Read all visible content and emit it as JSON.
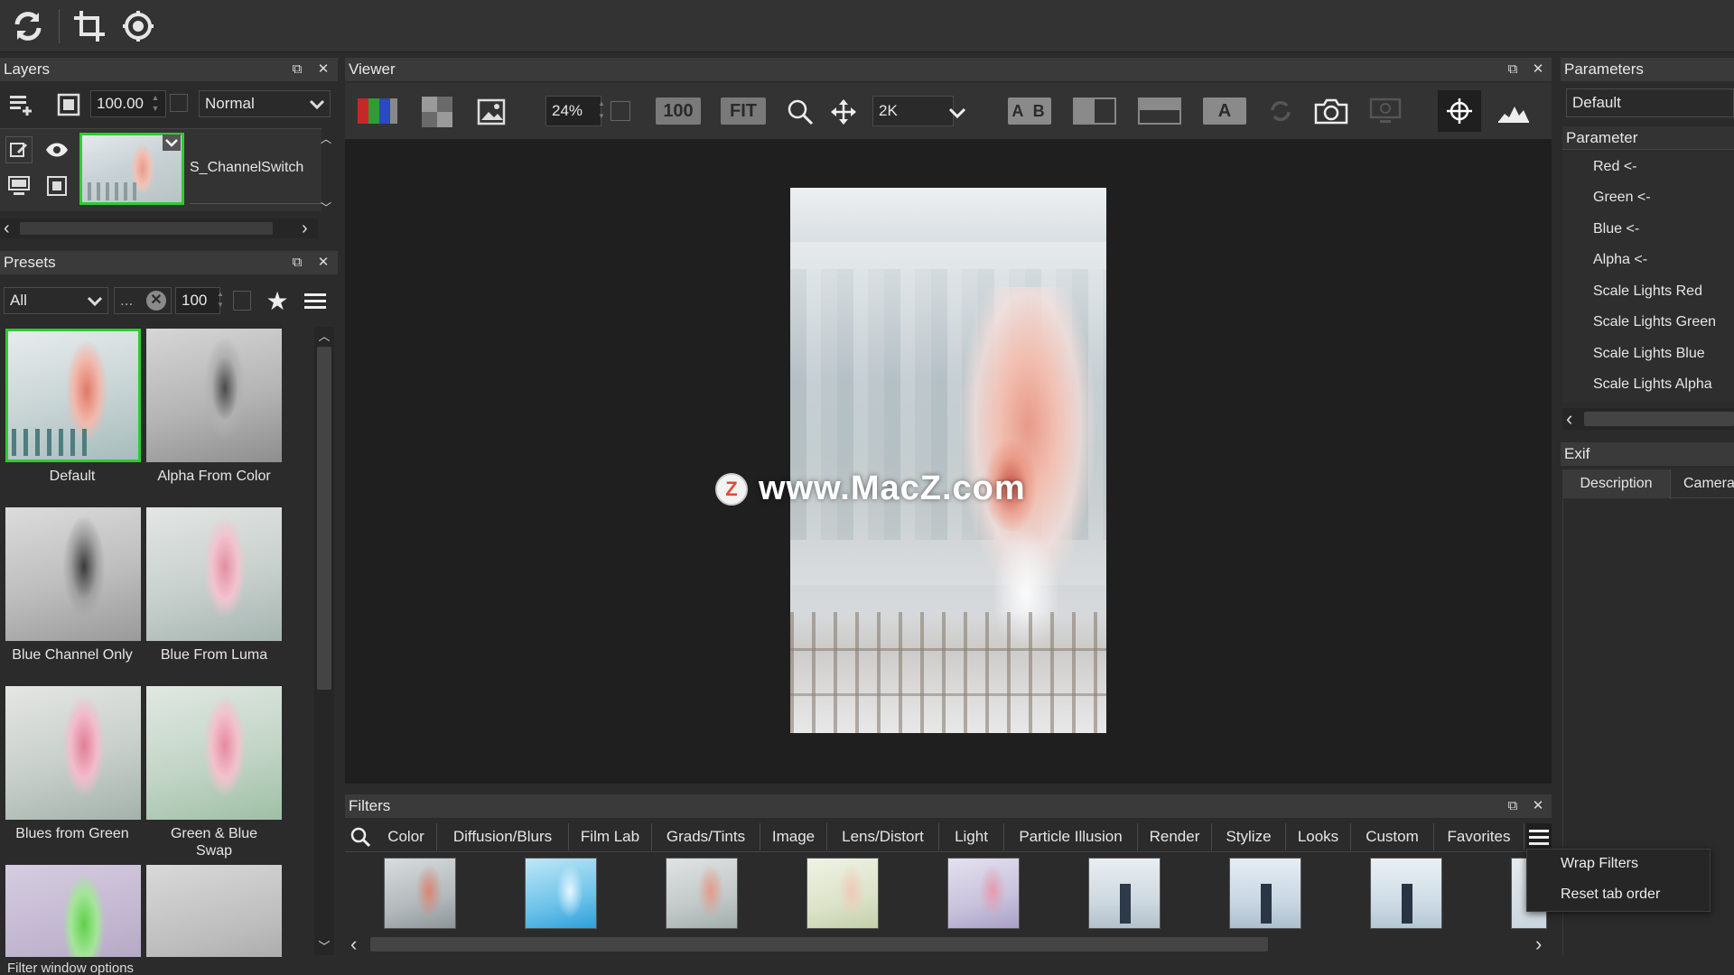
{
  "layers": {
    "title": "Layers",
    "opacity": "100.00",
    "blend_mode": "Normal",
    "layer_name": "S_ChannelSwitch"
  },
  "presets": {
    "title": "Presets",
    "category": "All",
    "search": "...",
    "amount": "100",
    "items": [
      {
        "label": "Default"
      },
      {
        "label": "Alpha From Color"
      },
      {
        "label": "Blue Channel Only"
      },
      {
        "label": "Blue From Luma"
      },
      {
        "label": "Blues from Green"
      },
      {
        "label": "Green & Blue"
      },
      {
        "label": "Swap"
      }
    ]
  },
  "viewer": {
    "title": "Viewer",
    "zoom": "24%",
    "btn_100": "100",
    "btn_fit": "FIT",
    "resolution": "2K",
    "watermark": "www.MacZ.com"
  },
  "parameters": {
    "title": "Parameters",
    "preset": "Default",
    "section": "Parameter",
    "items": [
      "Red <-",
      "Green <-",
      "Blue <-",
      "Alpha <-",
      "Scale Lights Red",
      "Scale Lights Green",
      "Scale Lights Blue",
      "Scale Lights Alpha"
    ]
  },
  "exif": {
    "title": "Exif",
    "tabs": [
      "Description",
      "Camera"
    ]
  },
  "filters": {
    "title": "Filters",
    "tabs": [
      "Color",
      "Diffusion/Blurs",
      "Film Lab",
      "Grads/Tints",
      "Image",
      "Lens/Distort",
      "Light",
      "Particle Illusion",
      "Render",
      "Stylize",
      "Looks",
      "Custom",
      "Favorites"
    ]
  },
  "context_menu": {
    "wrap": "Wrap Filters",
    "reset": "Reset tab order"
  },
  "status": {
    "text": "Filter window options"
  },
  "colors": {
    "accent_green": "#2ecc2e",
    "panel_bg": "#2b2b2b",
    "header_bg": "#3a3a3a",
    "viewer_bg": "#1f1f1f"
  }
}
